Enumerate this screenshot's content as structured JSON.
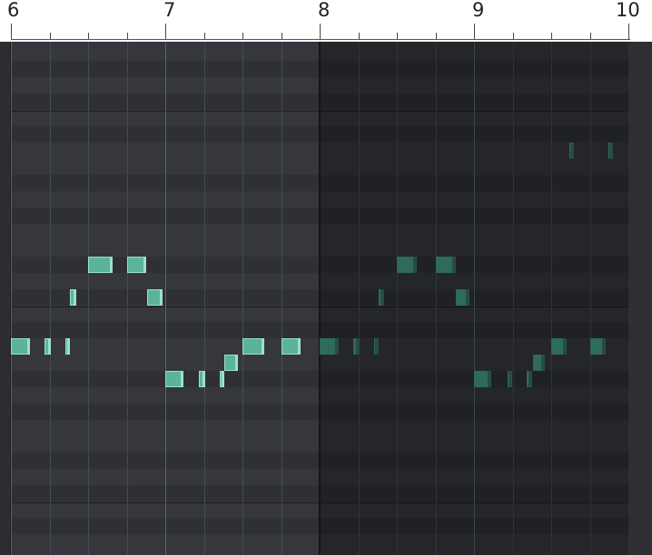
{
  "ruler": {
    "bars": [
      {
        "label": "6",
        "pos": 0
      },
      {
        "label": "7",
        "pos": 1
      },
      {
        "label": "8",
        "pos": 2
      },
      {
        "label": "9",
        "pos": 3
      },
      {
        "label": "10",
        "pos": 4
      }
    ],
    "beats_per_bar": 4
  },
  "piano_roll": {
    "row_count": 31,
    "black_key_pattern": [
      false,
      true,
      false,
      true,
      false,
      true,
      false,
      false,
      true,
      false,
      true,
      false
    ],
    "loop_end_bar": 8,
    "ghost_from_bar": 8,
    "colors": {
      "note_fill": "#5bb39b",
      "note_border": "#9ae0cd",
      "ghost_fill": "#2e6b5a",
      "white_row": "#35373c",
      "black_row": "#2e3034",
      "bar_line": "#5c6070",
      "beat_line": "#474a52"
    },
    "notes": [
      {
        "start": 6.0,
        "length": 0.125,
        "row": 18,
        "ghost": false
      },
      {
        "start": 6.22,
        "length": 0.04,
        "row": 18,
        "ghost": false
      },
      {
        "start": 6.35,
        "length": 0.035,
        "row": 18,
        "ghost": false
      },
      {
        "start": 6.38,
        "length": 0.045,
        "row": 15,
        "ghost": false
      },
      {
        "start": 6.5,
        "length": 0.16,
        "row": 13,
        "ghost": false
      },
      {
        "start": 6.75,
        "length": 0.125,
        "row": 13,
        "ghost": false
      },
      {
        "start": 6.88,
        "length": 0.1,
        "row": 15,
        "ghost": false
      },
      {
        "start": 7.0,
        "length": 0.12,
        "row": 20,
        "ghost": false
      },
      {
        "start": 7.22,
        "length": 0.04,
        "row": 20,
        "ghost": false
      },
      {
        "start": 7.35,
        "length": 0.035,
        "row": 20,
        "ghost": false
      },
      {
        "start": 7.38,
        "length": 0.09,
        "row": 19,
        "ghost": false
      },
      {
        "start": 7.5,
        "length": 0.14,
        "row": 18,
        "ghost": false
      },
      {
        "start": 7.75,
        "length": 0.125,
        "row": 18,
        "ghost": false
      },
      {
        "start": 8.0,
        "length": 0.125,
        "row": 18,
        "ghost": true
      },
      {
        "start": 8.22,
        "length": 0.04,
        "row": 18,
        "ghost": true
      },
      {
        "start": 8.35,
        "length": 0.035,
        "row": 18,
        "ghost": true
      },
      {
        "start": 8.38,
        "length": 0.035,
        "row": 15,
        "ghost": true
      },
      {
        "start": 8.5,
        "length": 0.13,
        "row": 13,
        "ghost": true
      },
      {
        "start": 8.75,
        "length": 0.13,
        "row": 13,
        "ghost": true
      },
      {
        "start": 8.88,
        "length": 0.09,
        "row": 15,
        "ghost": true
      },
      {
        "start": 9.0,
        "length": 0.11,
        "row": 20,
        "ghost": true
      },
      {
        "start": 9.22,
        "length": 0.025,
        "row": 20,
        "ghost": true
      },
      {
        "start": 9.34,
        "length": 0.035,
        "row": 20,
        "ghost": true
      },
      {
        "start": 9.38,
        "length": 0.08,
        "row": 19,
        "ghost": true
      },
      {
        "start": 9.5,
        "length": 0.1,
        "row": 18,
        "ghost": true
      },
      {
        "start": 9.75,
        "length": 0.1,
        "row": 18,
        "ghost": true
      },
      {
        "start": 9.62,
        "length": 0.03,
        "row": 6,
        "ghost": true
      },
      {
        "start": 9.87,
        "length": 0.025,
        "row": 6,
        "ghost": true
      }
    ]
  }
}
